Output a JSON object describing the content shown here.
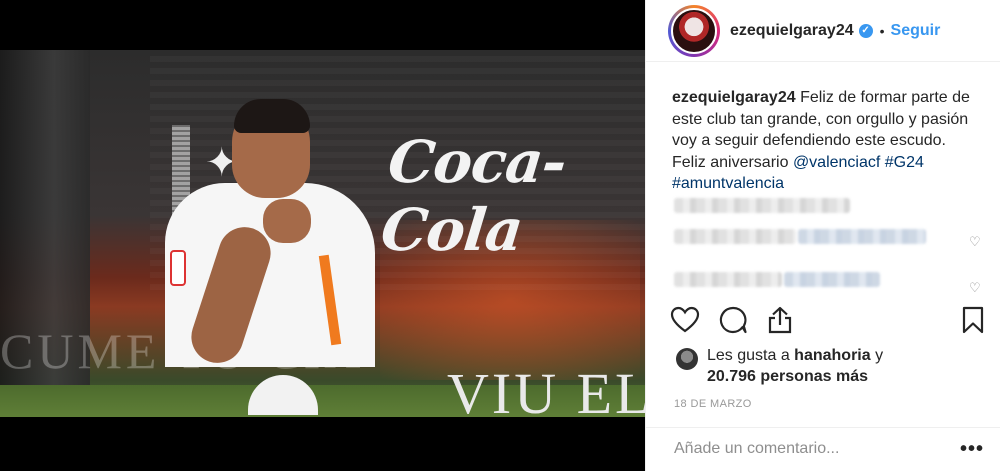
{
  "post": {
    "username": "ezequielgaray24",
    "verified_mark": "✓",
    "separator": "•",
    "follow_label": "Seguir"
  },
  "media": {
    "sponsor_logo": "Coca-Cola",
    "banner_text": "CUME TO  CIA",
    "viu_text": "VIU EL"
  },
  "caption": {
    "username": "ezequielgaray24",
    "text": " Feliz de formar parte de este club tan grande, con orgullo y pasión voy a seguir defendiendo este escudo. Feliz aniversario ",
    "mention": "@valenciacf",
    "hashtag1": "#G24",
    "hashtag2": "#amuntvalencia"
  },
  "actions": {
    "like_icon": "heart-icon",
    "comment_icon": "comment-icon",
    "share_icon": "share-icon",
    "save_icon": "bookmark-icon"
  },
  "likes": {
    "prefix": "Les gusta a ",
    "first_user": "hanahoria",
    "connector": " y",
    "count_text": "20.796 personas más"
  },
  "date": "18 DE MARZO",
  "comment": {
    "placeholder": "Añade un comentario...",
    "more_label": "•••"
  },
  "colors": {
    "accent": "#3897f0",
    "link": "#003569",
    "muted": "#999999"
  }
}
